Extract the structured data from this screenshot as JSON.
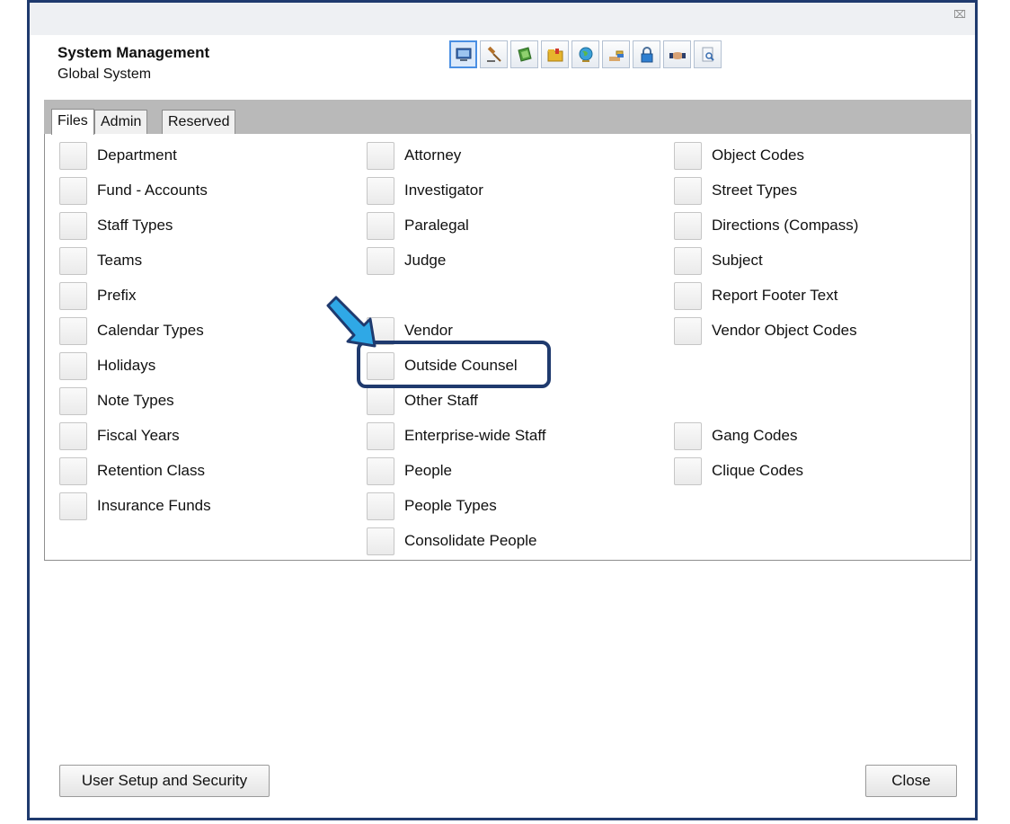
{
  "header": {
    "title": "System Management",
    "subtitle": "Global System"
  },
  "window": {
    "close_glyph": "⌧"
  },
  "toolbar": [
    {
      "icon": "monitor-icon",
      "active": true
    },
    {
      "icon": "gavel-icon"
    },
    {
      "icon": "book-icon"
    },
    {
      "icon": "folder-icon"
    },
    {
      "icon": "globe-icon"
    },
    {
      "icon": "hand-coins-icon"
    },
    {
      "icon": "lock-icon"
    },
    {
      "icon": "handshake-icon"
    },
    {
      "icon": "document-search-icon"
    }
  ],
  "tabs": [
    {
      "label": "Files",
      "active": true
    },
    {
      "label": "Admin"
    },
    {
      "label": "Reserved"
    }
  ],
  "columns": [
    [
      "Department",
      "Fund - Accounts",
      "Staff Types",
      "Teams",
      "Prefix",
      "Calendar Types",
      "Holidays",
      "Note Types",
      "Fiscal Years",
      "Retention Class",
      "Insurance Funds"
    ],
    [
      "Attorney",
      "Investigator",
      "Paralegal",
      "Judge",
      "",
      "Vendor",
      "Outside Counsel",
      "Other Staff",
      "Enterprise-wide Staff",
      "People",
      "People Types",
      "Consolidate People"
    ],
    [
      "Object Codes",
      "Street Types",
      "Directions (Compass)",
      "Subject",
      "Report Footer Text",
      "Vendor Object Codes",
      "",
      "",
      "Gang Codes",
      "Clique Codes"
    ]
  ],
  "footer": {
    "user_setup_label": "User Setup and Security",
    "close_label": "Close"
  },
  "colors": {
    "window_border": "#1f3a6e",
    "arrow": "#2fa8e6",
    "highlight": "#1f3a6e"
  }
}
